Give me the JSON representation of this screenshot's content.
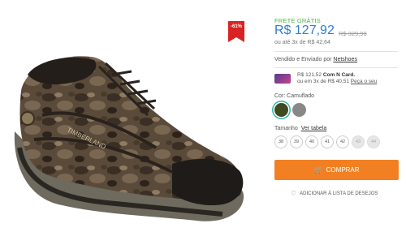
{
  "product": {
    "discount_badge": "-61%",
    "image_icon": "hiking-shoe-image"
  },
  "pricing": {
    "free_shipping": "FRETE GRÁTIS",
    "price": "R$ 127,92",
    "old_price": "R$ 329,90",
    "installments": "ou até 3x de R$ 42,64"
  },
  "seller": {
    "prefix": "Vendido e Enviado por ",
    "name": "Netshoes"
  },
  "card_offer": {
    "amount": "R$ 121,52",
    "bold_label": "Com N Card.",
    "line2_prefix": "ou em 3x de R$ 40,51 ",
    "link": "Peça o seu"
  },
  "color": {
    "label": "Cor: Camuflado",
    "swatches": [
      {
        "name": "Camuflado",
        "hex": "#3f4a1f",
        "selected": true
      },
      {
        "name": "Cinza",
        "hex": "#888888",
        "selected": false
      }
    ]
  },
  "size": {
    "label": "Tamanho",
    "table_link": "Ver tabela",
    "options": [
      {
        "value": "38",
        "available": true
      },
      {
        "value": "39",
        "available": true
      },
      {
        "value": "40",
        "available": true
      },
      {
        "value": "41",
        "available": true
      },
      {
        "value": "42",
        "available": true
      },
      {
        "value": "43",
        "available": false
      },
      {
        "value": "44",
        "available": false
      }
    ]
  },
  "actions": {
    "buy_label": "COMPRAR",
    "buy_icon": "cart-icon",
    "wishlist_label": "ADICIONAR À LISTA DE DESEJOS",
    "wishlist_icon": "heart-icon"
  },
  "colors": {
    "price_blue": "#2d7fcf",
    "free_shipping_green": "#4fb04a",
    "buy_orange": "#f28022",
    "badge_red": "#d92323"
  }
}
